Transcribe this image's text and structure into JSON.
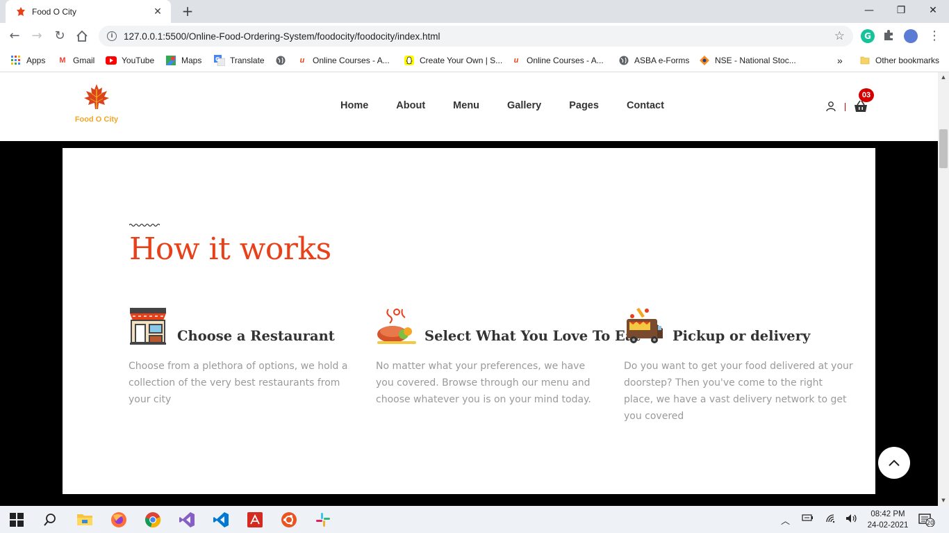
{
  "browser": {
    "tab_title": "Food O City",
    "url": "127.0.0.1:5500/Online-Food-Ordering-System/foodocity/foodocity/index.html",
    "bookmarks": [
      {
        "label": "Apps",
        "icon": "apps-grid-icon"
      },
      {
        "label": "Gmail",
        "icon": "gmail-icon"
      },
      {
        "label": "YouTube",
        "icon": "youtube-icon"
      },
      {
        "label": "Maps",
        "icon": "maps-icon"
      },
      {
        "label": "Translate",
        "icon": "translate-icon"
      },
      {
        "label": "",
        "icon": "globe-icon"
      },
      {
        "label": "Online Courses - A...",
        "icon": "udemy-icon"
      },
      {
        "label": "Create Your Own | S...",
        "icon": "snapchat-icon"
      },
      {
        "label": "Online Courses - A...",
        "icon": "udemy-icon"
      },
      {
        "label": "ASBA e-Forms",
        "icon": "globe-icon"
      },
      {
        "label": "NSE - National Stoc...",
        "icon": "nse-icon"
      }
    ],
    "overflow_label": "»",
    "other_bookmarks": "Other bookmarks"
  },
  "site": {
    "logo_text": "Food O City",
    "nav": [
      "Home",
      "About",
      "Menu",
      "Gallery",
      "Pages",
      "Contact"
    ],
    "cart_count": "03",
    "accent": "#e8411a"
  },
  "section": {
    "title": "How it works",
    "features": [
      {
        "title": "Choose a Restaurant",
        "icon": "restaurant-icon",
        "description": "Choose from a plethora of options, we hold a collection of the very best restaurants from your city"
      },
      {
        "title": "Select What You Love To Eat",
        "icon": "food-plate-icon",
        "description": "No matter what your preferences, we have you covered. Browse through our menu and choose whatever you is on your mind today."
      },
      {
        "title": "Pickup or delivery",
        "icon": "food-truck-icon",
        "description": "Do you want to get your food delivered at your doorstep? Then you've come to the right place, we have a vast delivery network to get you covered"
      }
    ]
  },
  "taskbar": {
    "time": "08:42 PM",
    "date": "24-02-2021",
    "notifications": "20"
  }
}
